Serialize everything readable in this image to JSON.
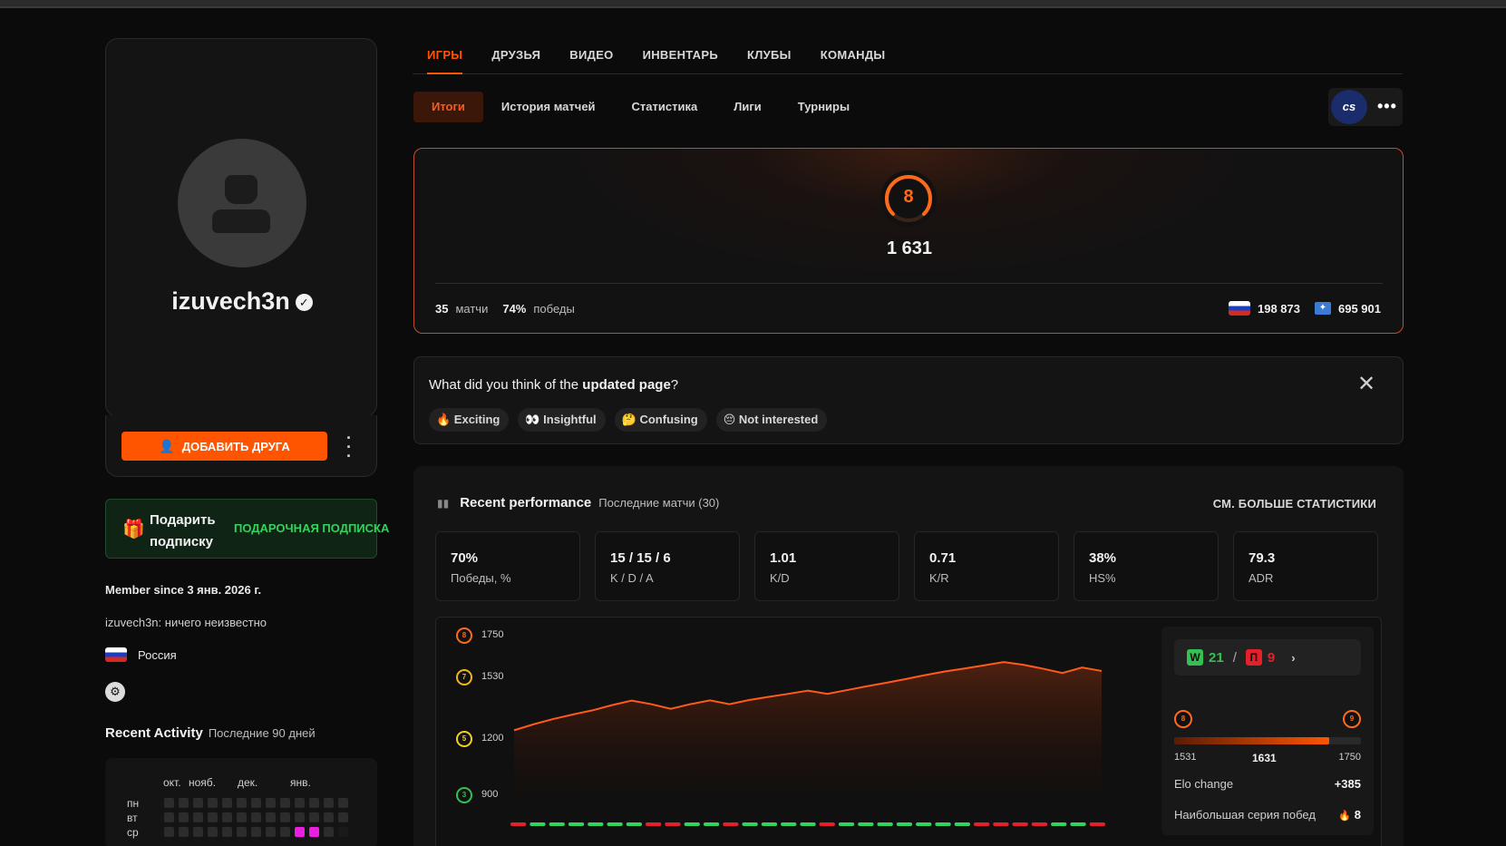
{
  "profile": {
    "username": "izuvech3n",
    "add_friend_label": "ДОБАВИТЬ ДРУГА",
    "gift_label": "Подарить подписку",
    "gift_link": "ПОДАРОЧНАЯ ПОДПИСКА",
    "member_since": "Member since 3 янв. 2026 г.",
    "bio": "izuvech3n: ничего неизвестно",
    "country": "Россия"
  },
  "activity": {
    "title": "Recent Activity",
    "subtitle": "Последние 90 дней",
    "months": [
      "окт.",
      "нояб.",
      "дек.",
      "янв."
    ],
    "days": [
      "пн",
      "вт",
      "ср"
    ]
  },
  "main_tabs": [
    "ИГРЫ",
    "ДРУЗЬЯ",
    "ВИДЕО",
    "ИНВЕНТАРЬ",
    "КЛУБЫ",
    "КОМАНДЫ"
  ],
  "sub_tabs": [
    "Итоги",
    "История матчей",
    "Статистика",
    "Лиги",
    "Турниры"
  ],
  "game_icon_label": "cs",
  "elo": {
    "level": "8",
    "value": "1 631",
    "matches_value": "35",
    "matches_label": "матчи",
    "winrate_value": "74%",
    "winrate_label": "победы",
    "country_rank": "198 873",
    "region_rank": "695 901"
  },
  "feedback": {
    "question_prefix": "What did you think of the",
    "question_bold": "updated page",
    "question_suffix": "?",
    "reactions": [
      "🔥 Exciting",
      "👀 Insightful",
      "🤔 Confusing",
      "😔 Not interested"
    ]
  },
  "performance": {
    "title": "Recent performance",
    "subtitle": "Последние матчи (30)",
    "more_link": "СМ. БОЛЬШЕ СТАТИСТИКИ",
    "tiles": [
      {
        "value": "70%",
        "label": "Победы, %"
      },
      {
        "value": "15 / 15 / 6",
        "label": "K / D / A"
      },
      {
        "value": "1.01",
        "label": "K/D"
      },
      {
        "value": "0.71",
        "label": "K/R"
      },
      {
        "value": "38%",
        "label": "HS%"
      },
      {
        "value": "79.3",
        "label": "ADR"
      }
    ],
    "wins": "21",
    "losses": "9",
    "w_letter": "W",
    "l_letter": "П",
    "range_min": "1531",
    "range_current": "1631",
    "range_max": "1750",
    "range_min_level": "8",
    "range_max_level": "9",
    "progress_fraction": 0.83,
    "elo_change_label": "Elo change",
    "elo_change_value": "+385",
    "streak_label": "Наибольшая серия побед",
    "streak_value": "8"
  },
  "chart_data": {
    "type": "area",
    "yticks": [
      {
        "value": 1750,
        "label": "1750",
        "level": "8",
        "color": "#ff6a1a"
      },
      {
        "value": 1530,
        "label": "1530",
        "level": "7",
        "color": "#f5b51a"
      },
      {
        "value": 1200,
        "label": "1200",
        "level": "5",
        "color": "#f5d21a"
      },
      {
        "value": 900,
        "label": "900",
        "level": "3",
        "color": "#32c152"
      }
    ],
    "ylim": [
      900,
      1750
    ],
    "x": [
      1,
      2,
      3,
      4,
      5,
      6,
      7,
      8,
      9,
      10,
      11,
      12,
      13,
      14,
      15,
      16,
      17,
      18,
      19,
      20,
      21,
      22,
      23,
      24,
      25,
      26,
      27,
      28,
      29,
      30,
      31
    ],
    "values": [
      1246,
      1278,
      1306,
      1330,
      1352,
      1380,
      1404,
      1385,
      1360,
      1385,
      1405,
      1385,
      1407,
      1424,
      1440,
      1457,
      1440,
      1460,
      1480,
      1499,
      1519,
      1540,
      1559,
      1575,
      1592,
      1609,
      1595,
      1574,
      1551,
      1580,
      1562
    ],
    "results": [
      "L",
      "W",
      "W",
      "W",
      "W",
      "W",
      "W",
      "L",
      "L",
      "W",
      "W",
      "L",
      "W",
      "W",
      "W",
      "W",
      "L",
      "W",
      "W",
      "W",
      "W",
      "W",
      "W",
      "W",
      "L",
      "L",
      "L",
      "L",
      "W",
      "W",
      "L"
    ],
    "colors": {
      "line": "#ff5a1a",
      "win": "#32d35a",
      "loss": "#e5202b"
    }
  }
}
